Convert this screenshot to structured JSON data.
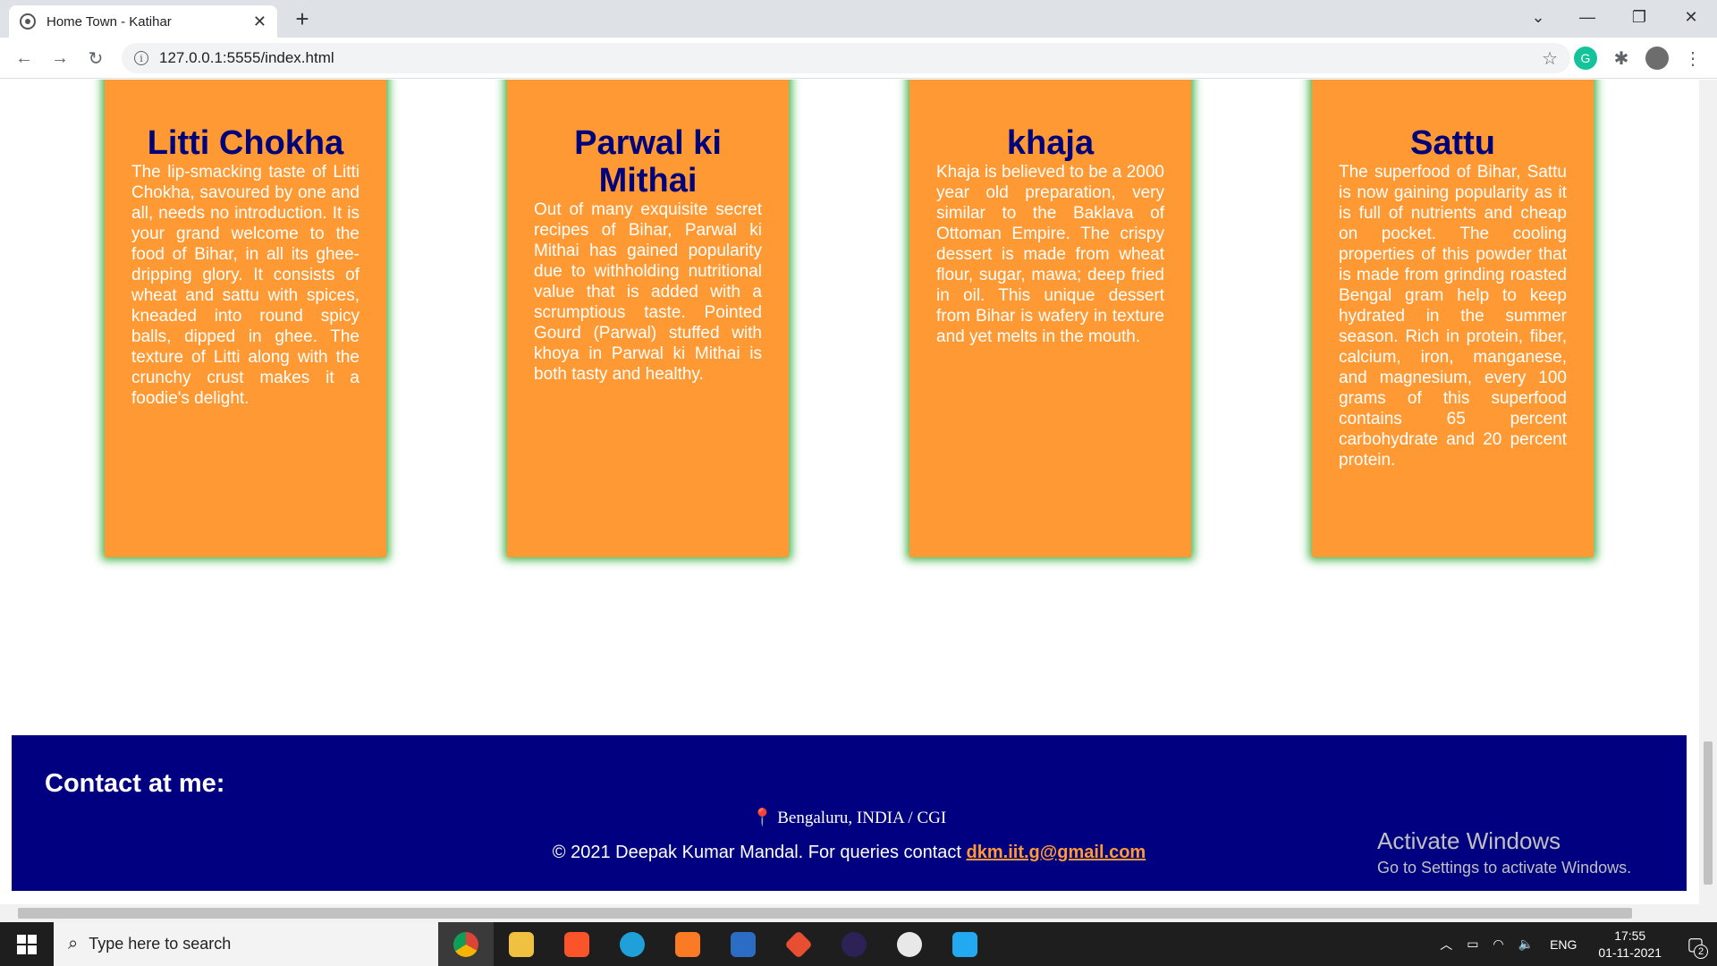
{
  "browser": {
    "tab_title": "Home Town - Katihar",
    "url": "127.0.0.1:5555/index.html"
  },
  "cards": [
    {
      "title": "Litti Chokha",
      "text": "The lip-smacking taste of Litti Chokha, savoured by one and all, needs no introduction. It is your grand welcome to the food of Bihar, in all its ghee-dripping glory. It consists of wheat and sattu with spices, kneaded into round spicy balls, dipped in ghee. The texture of Litti along with the crunchy crust makes it a foodie's delight."
    },
    {
      "title": "Parwal ki Mithai",
      "text": "Out of many exquisite secret recipes of Bihar, Parwal ki Mithai has gained popularity due to withholding nutritional value that is added with a scrumptious taste. Pointed Gourd (Parwal) stuffed with khoya in Parwal ki Mithai is both tasty and healthy."
    },
    {
      "title": "khaja",
      "text": "Khaja is believed to be a 2000 year old preparation, very similar to the Baklava of Ottoman Empire. The crispy dessert is made from wheat flour, sugar, mawa; deep fried in oil. This unique dessert from Bihar is wafery in texture and yet melts in the mouth."
    },
    {
      "title": "Sattu",
      "text": "The superfood of Bihar, Sattu is now gaining popularity as it is full of nutrients and cheap on pocket. The cooling properties of this powder that is made from grinding roasted Bengal gram help to keep hydrated in the summer season. Rich in protein, fiber, calcium, iron, manganese, and magnesium, every 100 grams of this superfood contains 65 percent carbohydrate and 20 percent protein."
    }
  ],
  "footer": {
    "heading": "Contact at me:",
    "location": "Bengaluru, INDIA / CGI",
    "copyright": "© 2021 Deepak Kumar Mandal. For queries contact",
    "email": "dkm.iit.g@gmail.com"
  },
  "watermark": {
    "line1": "Activate Windows",
    "line2": "Go to Settings to activate Windows."
  },
  "taskbar": {
    "search_placeholder": "Type here to search",
    "language": "ENG",
    "time": "17:55",
    "date": "01-11-2021",
    "notifications": "2"
  },
  "colors": {
    "card_bg": "#ff9933",
    "card_title": "#00007a",
    "card_shadow": "#3cb043",
    "footer_bg": "#000080",
    "link": "#ff9933"
  }
}
